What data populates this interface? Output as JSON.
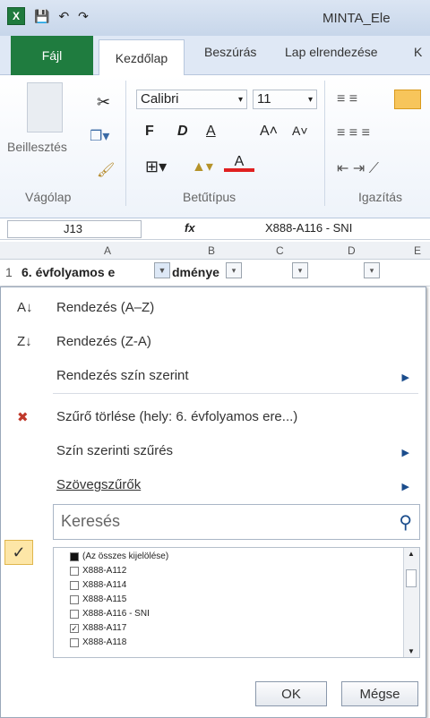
{
  "window": {
    "title": "MINTA_Ele"
  },
  "tabs": [
    "Fájl",
    "Kezdőlap",
    "Beszúrás",
    "Lap elrendezése",
    "K"
  ],
  "ribbon": {
    "paste_label": "Beillesztés",
    "font_name": "Calibri",
    "font_size": "11",
    "bold": "F",
    "italic": "D",
    "underline": "A",
    "groups": [
      "Vágólap",
      "Betűtípus",
      "Igazítás"
    ]
  },
  "formula_bar": {
    "cell": "J13",
    "fx": "fx",
    "value": "X888-A116 - SNI"
  },
  "columns": [
    "A",
    "B",
    "C",
    "D",
    "E"
  ],
  "row1": {
    "num": "1",
    "text": "6. évfolyamos e",
    "text2": "dménye"
  },
  "menu": {
    "sort_az": "Rendezés (A–Z)",
    "sort_za": "Rendezés (Z-A)",
    "sort_color": "Rendezés szín szerint",
    "clear_filter": "Szűrő törlése (hely: 6. évfolyamos ere...)",
    "color_filter": "Szín szerinti szűrés",
    "text_filters": "Szövegszűrők",
    "search_placeholder": "Keresés",
    "list": [
      {
        "label": "(Az összes kijelölése)",
        "state": "partial"
      },
      {
        "label": "X888-A112",
        "state": "unchecked"
      },
      {
        "label": "X888-A114",
        "state": "unchecked"
      },
      {
        "label": "X888-A115",
        "state": "unchecked"
      },
      {
        "label": "X888-A116 - SNI",
        "state": "unchecked"
      },
      {
        "label": "X888-A117",
        "state": "checked"
      },
      {
        "label": "X888-A118",
        "state": "unchecked"
      }
    ],
    "ok": "OK",
    "cancel": "Mégse"
  }
}
